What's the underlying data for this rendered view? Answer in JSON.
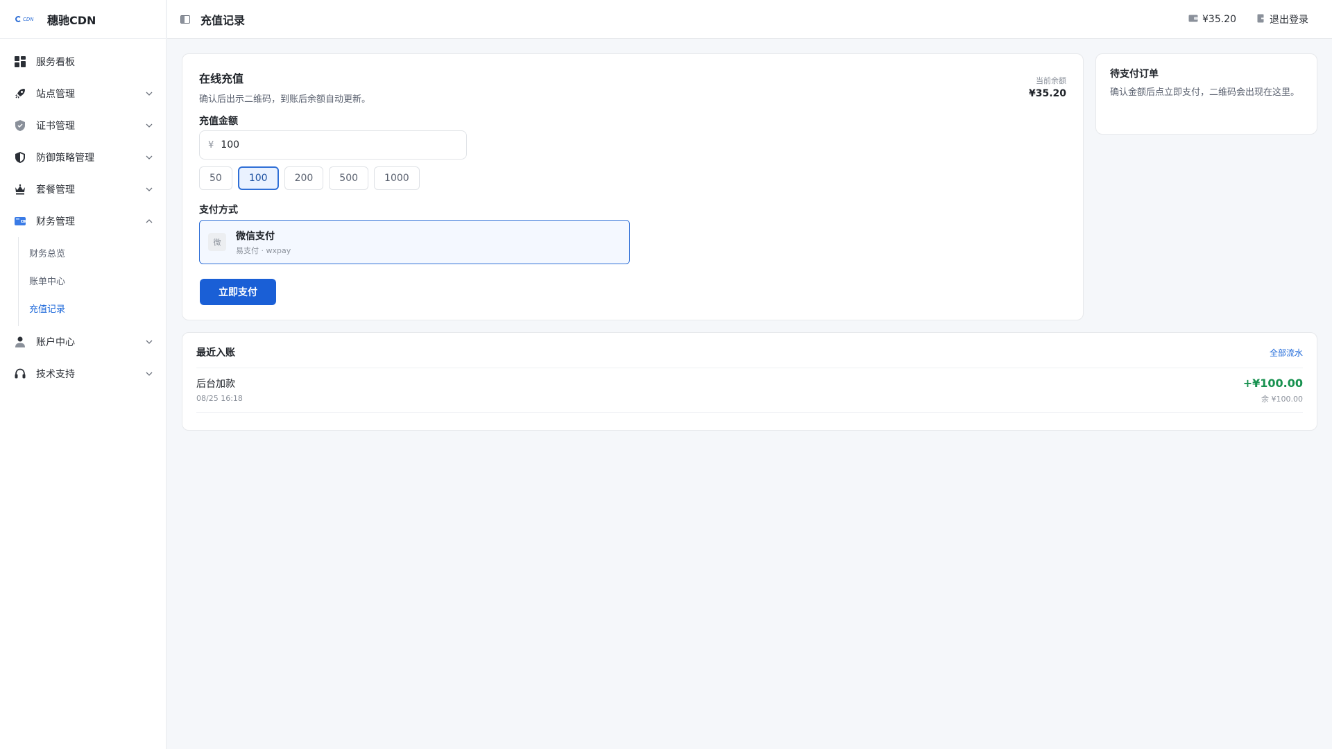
{
  "brand": {
    "logo_text": "穗驰CDN",
    "name": "穗驰CDN"
  },
  "sidebar": {
    "items": [
      {
        "label": "服务看板",
        "icon": "dashboard-icon",
        "expandable": false
      },
      {
        "label": "站点管理",
        "icon": "rocket-icon",
        "expandable": true
      },
      {
        "label": "证书管理",
        "icon": "shield-check-icon",
        "expandable": true
      },
      {
        "label": "防御策略管理",
        "icon": "shield-half-icon",
        "expandable": true
      },
      {
        "label": "套餐管理",
        "icon": "crown-icon",
        "expandable": true
      },
      {
        "label": "财务管理",
        "icon": "wallet-icon",
        "expandable": true,
        "expanded": true,
        "children": [
          {
            "label": "财务总览"
          },
          {
            "label": "账单中心"
          },
          {
            "label": "充值记录",
            "active": true
          }
        ]
      },
      {
        "label": "账户中心",
        "icon": "user-icon",
        "expandable": true
      },
      {
        "label": "技术支持",
        "icon": "headset-icon",
        "expandable": true
      }
    ]
  },
  "header": {
    "title": "充值记录",
    "balance": "¥35.20",
    "logout": "退出登录"
  },
  "recharge": {
    "title": "在线充值",
    "desc": "确认后出示二维码，到账后余额自动更新。",
    "balance_label": "当前余额",
    "balance_value": "¥35.20",
    "amount_label": "充值金额",
    "currency_symbol": "¥",
    "amount_value": "100",
    "presets": [
      "50",
      "100",
      "200",
      "500",
      "1000"
    ],
    "selected_preset": "100",
    "payment_label": "支付方式",
    "payment": {
      "badge": "微",
      "name": "微信支付",
      "sub": "易支付 · wxpay"
    },
    "submit_label": "立即支付"
  },
  "pending": {
    "title": "待支付订单",
    "desc": "确认金额后点立即支付，二维码会出现在这里。"
  },
  "recent": {
    "title": "最近入账",
    "link": "全部流水",
    "rows": [
      {
        "name": "后台加款",
        "time": "08/25 16:18",
        "amount": "+¥100.00",
        "balance": "余 ¥100.00"
      }
    ]
  },
  "colors": {
    "accent": "#1a5fd6",
    "positive": "#17914f",
    "link": "#1a66d9"
  }
}
